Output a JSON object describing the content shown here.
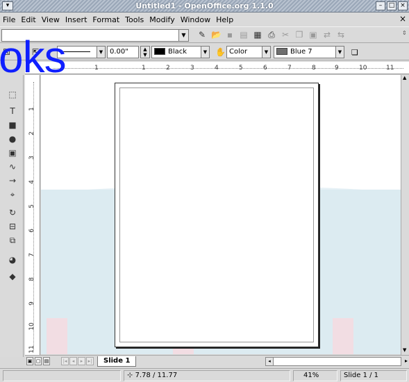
{
  "window": {
    "title": "Untitled1 - OpenOffice.org 1.1.0"
  },
  "menu": {
    "items": [
      "File",
      "Edit",
      "View",
      "Insert",
      "Format",
      "Tools",
      "Modify",
      "Window",
      "Help"
    ]
  },
  "toolbar1": {
    "url_value": ""
  },
  "toolbar2": {
    "line_width": "0.00\"",
    "line_color_label": "Black",
    "line_color": "#000000",
    "area_style": "Color",
    "area_color_label": "Blue 7",
    "area_color": "#6f6f6f"
  },
  "watermark": "oks",
  "hruler_ticks": [
    "1",
    "1",
    "2",
    "3",
    "4",
    "5",
    "6",
    "7",
    "8",
    "9",
    "10",
    "11"
  ],
  "vruler_ticks": [
    "1",
    "2",
    "3",
    "4",
    "5",
    "6",
    "7",
    "8",
    "9",
    "10",
    "11"
  ],
  "tabs": {
    "slide_tab": "Slide 1"
  },
  "status": {
    "position": "7.78 / 11.77",
    "zoom": "41%",
    "slide_info": "Slide 1 / 1"
  }
}
